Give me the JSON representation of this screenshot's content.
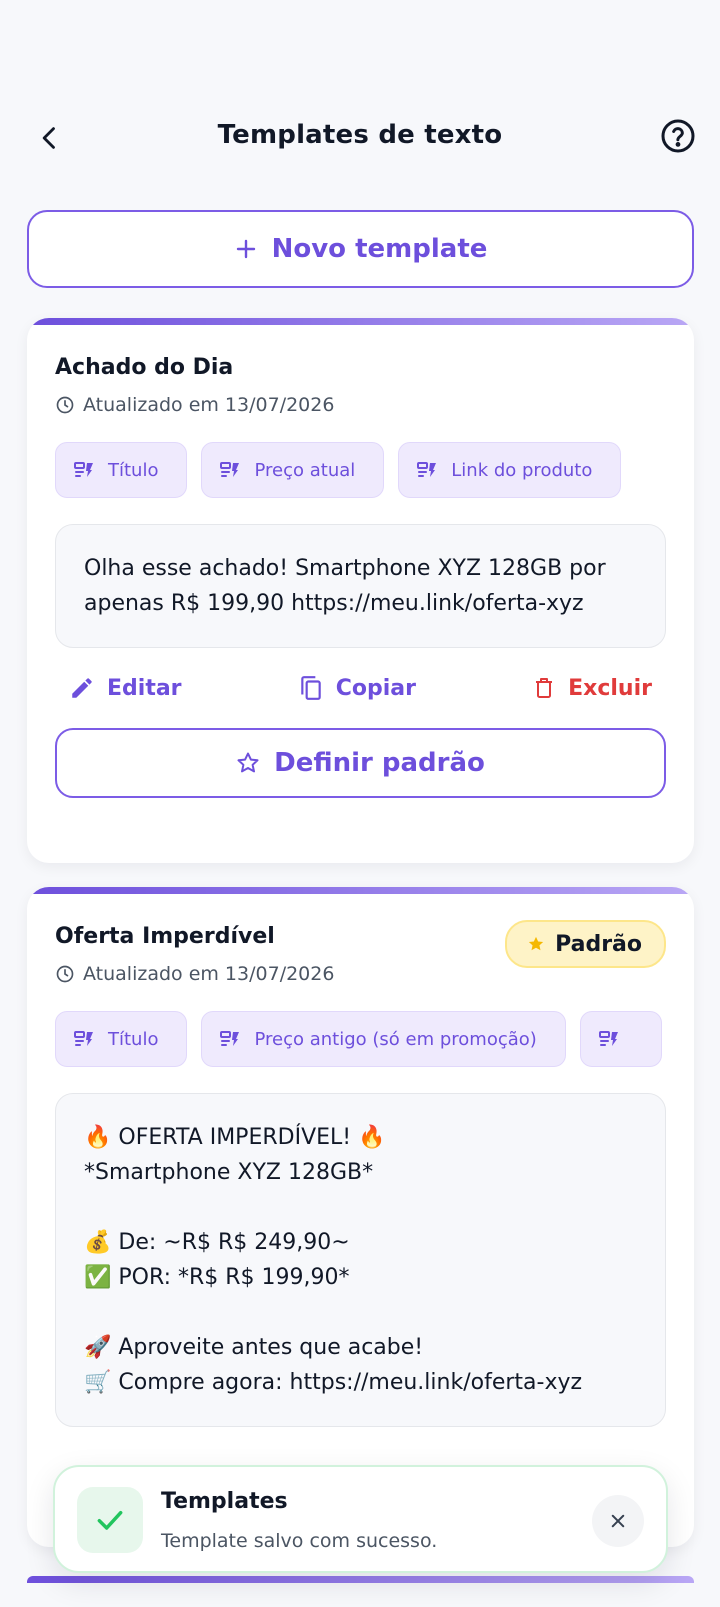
{
  "header": {
    "title": "Templates de texto",
    "back_icon": "chevron-left-icon",
    "help_icon": "help-circle-icon"
  },
  "new_button": {
    "icon": "plus-icon",
    "label": "Novo template"
  },
  "cards": [
    {
      "name": "Achado do Dia",
      "updated": "Atualizado em 13/07/2026",
      "chips": [
        "Título",
        "Preço atual",
        "Link do produto"
      ],
      "preview": "Olha esse achado! Smartphone XYZ 128GB por apenas R$ 199,90 https://meu.link/oferta-xyz",
      "actions": {
        "edit": "Editar",
        "copy": "Copiar",
        "delete": "Excluir"
      },
      "default_button": "Definir padrão"
    },
    {
      "name": "Oferta Imperdível",
      "badge": "Padrão",
      "updated": "Atualizado em 13/07/2026",
      "chips": [
        "Título",
        "Preço antigo (só em promoção)",
        ""
      ],
      "preview_lines": [
        "🔥 OFERTA IMPERDÍVEL! 🔥",
        "*Smartphone XYZ 128GB*",
        "",
        "💰 De: ~R$ R$ 249,90~",
        "✅ POR: *R$ R$ 199,90*",
        "",
        "🚀 Aproveite antes que acabe!",
        "🛒 Compre agora: https://meu.link/oferta-xyz"
      ]
    }
  ],
  "toast": {
    "title": "Templates",
    "message": "Template salvo com sucesso."
  },
  "colors": {
    "accent": "#6d4fdc",
    "danger": "#e03b3b",
    "success": "#22c55e",
    "badge_bg": "#fef3c7"
  }
}
